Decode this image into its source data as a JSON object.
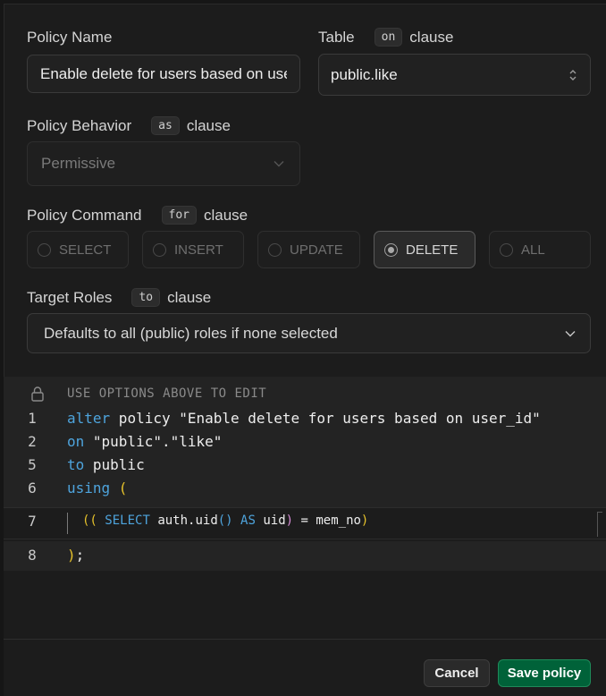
{
  "form": {
    "policy_name": {
      "label": "Policy Name",
      "value": "Enable delete for users based on user_id"
    },
    "table": {
      "label": "Table",
      "chip": "on",
      "suffix": "clause",
      "value": "public.like"
    },
    "behavior": {
      "label": "Policy Behavior",
      "chip": "as",
      "suffix": "clause",
      "value": "Permissive"
    },
    "command": {
      "label": "Policy Command",
      "chip": "for",
      "suffix": "clause",
      "options": [
        "SELECT",
        "INSERT",
        "UPDATE",
        "DELETE",
        "ALL"
      ],
      "selected": "DELETE"
    },
    "roles": {
      "label": "Target Roles",
      "chip": "to",
      "suffix": "clause",
      "placeholder": "Defaults to all (public) roles if none selected"
    }
  },
  "editor": {
    "hint": "USE OPTIONS ABOVE TO EDIT",
    "line_numbers": [
      "1",
      "2",
      "5",
      "6",
      "7",
      "8"
    ],
    "l1_kw": "alter",
    "l1_rest": " policy \"Enable delete for users based on user_id\"",
    "l2_kw": "on",
    "l2_rest": " \"public\".\"like\"",
    "l5_kw": "to",
    "l5_rest": " public",
    "l6_kw": "using",
    "l6_paren": " (",
    "l7_open": "((",
    "l7_select": "SELECT",
    "l7_fn": "auth.uid",
    "l7_call": "()",
    "l7_as": "AS",
    "l7_rest": " uid",
    "l7_close": ")",
    "l7_tail": " = mem_no",
    "l7_end": ")",
    "l8_paren": ")",
    "l8_semi": ";"
  },
  "footer": {
    "cancel": "Cancel",
    "save": "Save policy"
  },
  "colors": {
    "keyword": "#4ea4dd",
    "paren": "#e6c22b",
    "save_button": "#006239"
  }
}
